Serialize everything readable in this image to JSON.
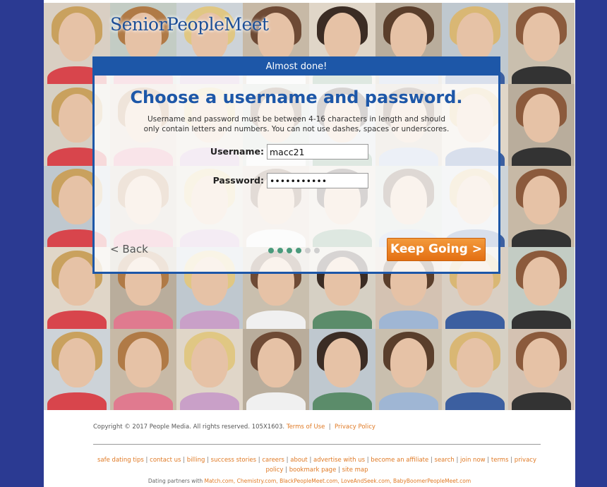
{
  "brand": {
    "logo_text": "SeniorPeopleMeet"
  },
  "modal": {
    "header": "Almost done!",
    "title": "Choose a username and password.",
    "description": "Username and password must be between 4-16 characters in length and should only contain letters and numbers. You can not use dashes, spaces or underscores.",
    "username_label": "Username:",
    "username_value": "macc21",
    "password_label": "Password:",
    "password_value": "macc21macc2",
    "back_label": "< Back",
    "keep_going_label": "Keep Going >",
    "progress": {
      "total_steps": 6,
      "completed_steps": 4
    },
    "colors": {
      "accent": "#1d57a8",
      "button": "#e9781b",
      "dot_active": "#4a9a7c",
      "dot_inactive": "#cfcfcf"
    }
  },
  "footer": {
    "copyright": "Copyright © 2017 People Media. All rights reserved. 105X1603.",
    "terms_link": "Terms of Use",
    "privacy_link": "Privacy Policy",
    "nav_links": [
      "safe dating tips",
      "contact us",
      "billing",
      "success stories",
      "careers",
      "about",
      "advertise with us",
      "become an affiliate",
      "search",
      "join now",
      "terms",
      "privacy policy",
      "bookmark page",
      "site map"
    ],
    "partners_prefix": "Dating partners with",
    "partners": [
      "Match.com",
      "Chemistry.com",
      "BlackPeopleMeet.com",
      "LoveAndSeek.com",
      "BabyBoomerPeopleMeet.com"
    ]
  }
}
